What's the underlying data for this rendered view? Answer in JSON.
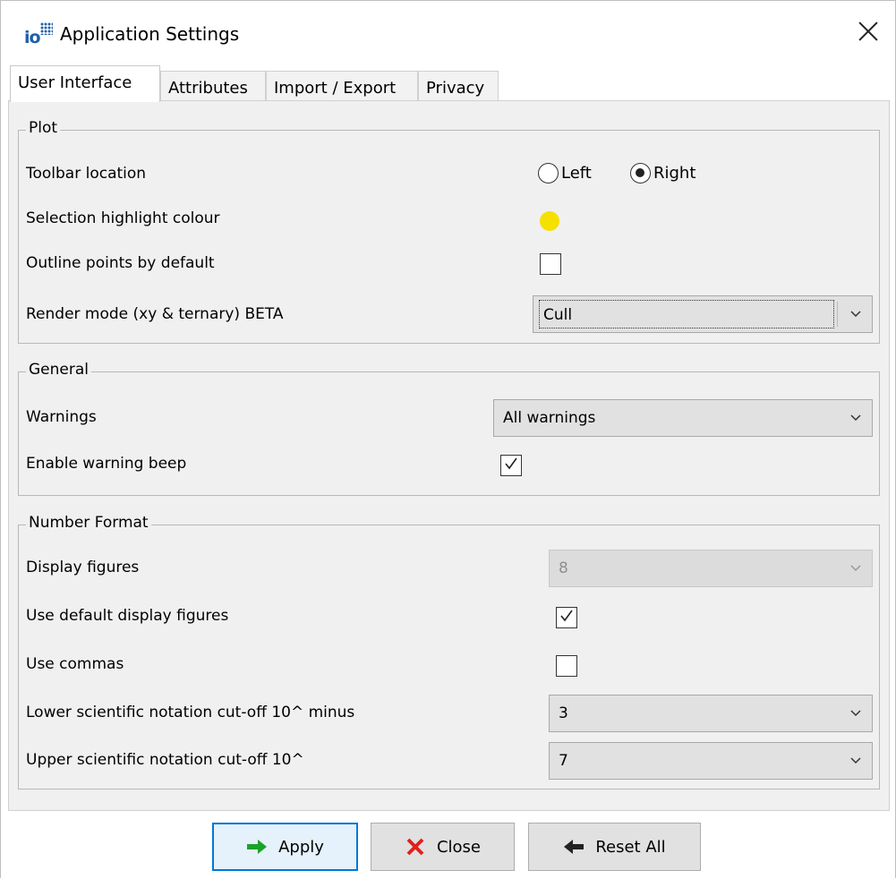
{
  "window": {
    "title": "Application Settings"
  },
  "tabs": [
    {
      "label": "User Interface",
      "active": true
    },
    {
      "label": "Attributes",
      "active": false
    },
    {
      "label": "Import / Export",
      "active": false
    },
    {
      "label": "Privacy",
      "active": false
    }
  ],
  "plot": {
    "legend": "Plot",
    "toolbar_location_label": "Toolbar location",
    "toolbar_options": [
      {
        "label": "Left",
        "selected": false
      },
      {
        "label": "Right",
        "selected": true
      }
    ],
    "highlight_label": "Selection highlight colour",
    "highlight_color": "#f5e000",
    "outline_label": "Outline points by default",
    "outline_checked": false,
    "render_label": "Render mode (xy & ternary) BETA",
    "render_value": "Cull"
  },
  "general": {
    "legend": "General",
    "warnings_label": "Warnings",
    "warnings_value": "All warnings",
    "beep_label": "Enable warning beep",
    "beep_checked": true
  },
  "number_format": {
    "legend": "Number Format",
    "display_figures_label": "Display figures",
    "display_figures_value": "8",
    "default_figures_label": "Use default display figures",
    "default_figures_checked": true,
    "commas_label": "Use commas",
    "commas_checked": false,
    "lower_label": "Lower scientific notation cut-off 10^ minus",
    "lower_value": "3",
    "upper_label": "Upper scientific notation cut-off 10^",
    "upper_value": "7"
  },
  "buttons": {
    "apply": "Apply",
    "close": "Close",
    "reset": "Reset All"
  },
  "colors": {
    "apply_arrow": "#1aa32a",
    "close_x": "#e0201b",
    "focus_border": "#0078d7"
  }
}
